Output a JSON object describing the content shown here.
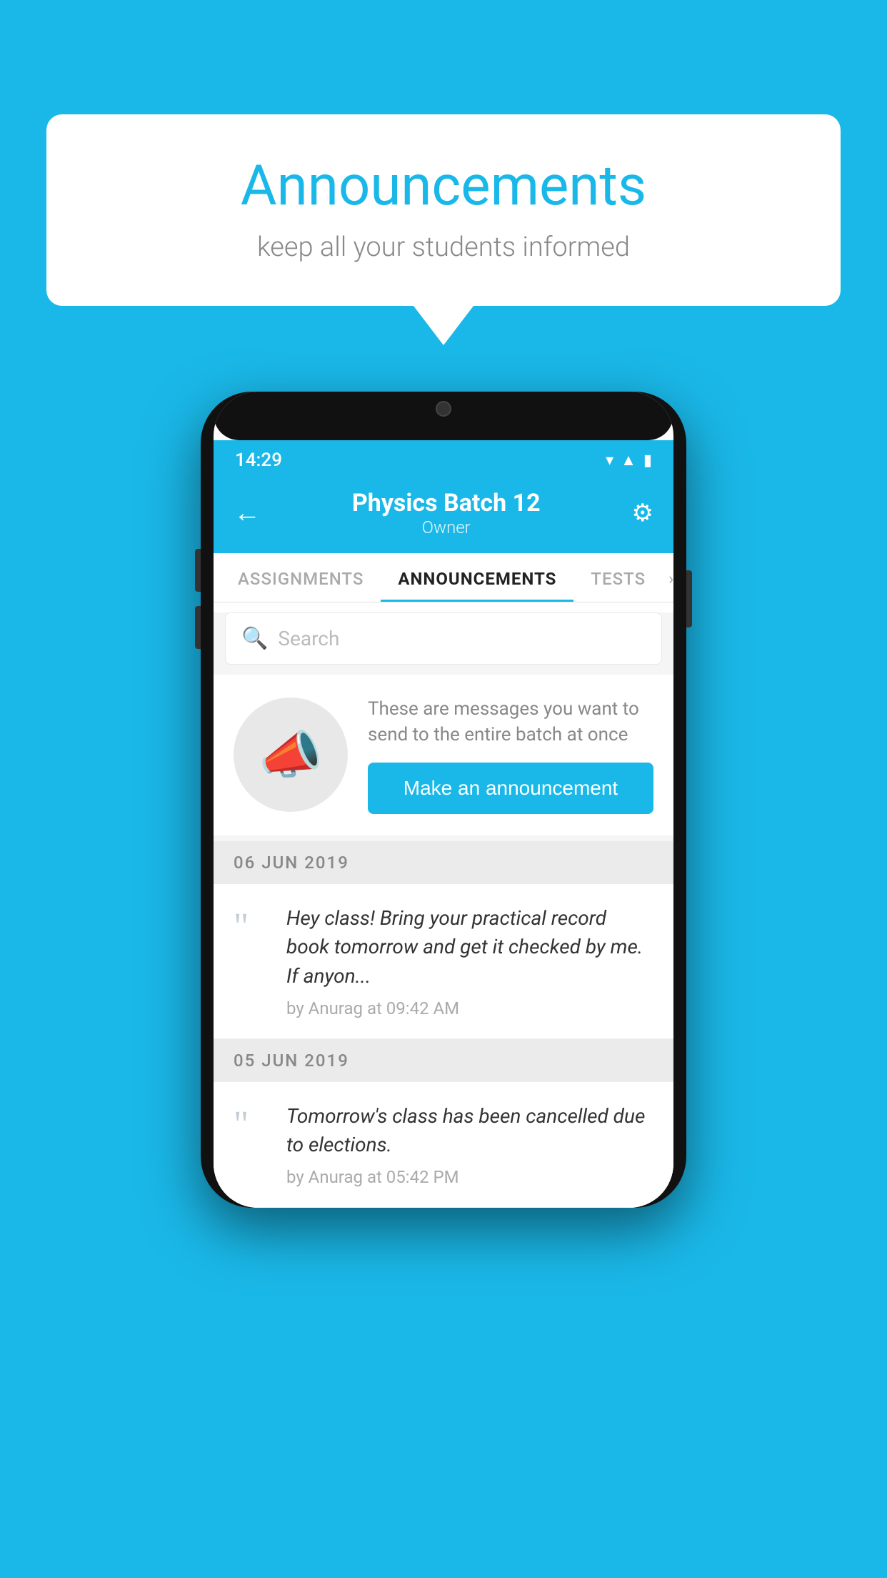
{
  "background_color": "#1ab8e8",
  "speech_bubble": {
    "title": "Announcements",
    "subtitle": "keep all your students informed"
  },
  "phone": {
    "status_bar": {
      "time": "14:29",
      "icons": [
        "wifi",
        "signal",
        "battery"
      ]
    },
    "header": {
      "back_label": "←",
      "title": "Physics Batch 12",
      "subtitle": "Owner",
      "gear_icon": "⚙"
    },
    "tabs": [
      {
        "label": "ASSIGNMENTS",
        "active": false
      },
      {
        "label": "ANNOUNCEMENTS",
        "active": true
      },
      {
        "label": "TESTS",
        "active": false
      }
    ],
    "search": {
      "placeholder": "Search"
    },
    "announcement_prompt": {
      "description": "These are messages you want to send to the entire batch at once",
      "button_label": "Make an announcement"
    },
    "announcements": [
      {
        "date": "06  JUN  2019",
        "text": "Hey class! Bring your practical record book tomorrow and get it checked by me. If anyon...",
        "meta": "by Anurag at 09:42 AM"
      },
      {
        "date": "05  JUN  2019",
        "text": "Tomorrow's class has been cancelled due to elections.",
        "meta": "by Anurag at 05:42 PM"
      }
    ]
  }
}
